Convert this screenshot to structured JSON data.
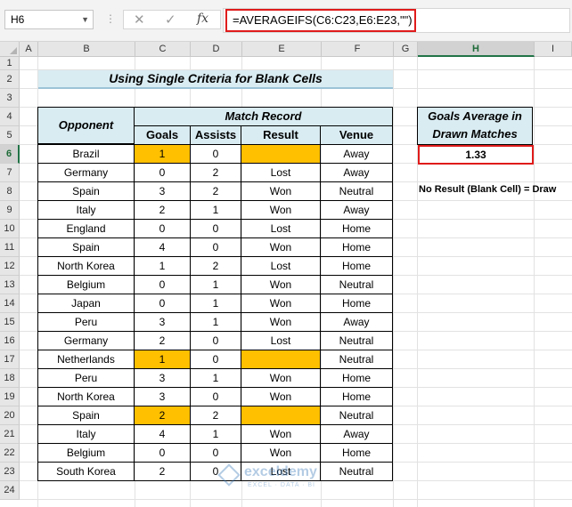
{
  "formula_bar": {
    "name_box": "H6",
    "dropdown_icon": "chevron-down-icon",
    "cancel_icon": "close-icon",
    "enter_icon": "checkmark-icon",
    "function_icon": "fx",
    "formula": "=AVERAGEIFS(C6:C23,E6:E23,\"\")"
  },
  "columns": [
    "A",
    "B",
    "C",
    "D",
    "E",
    "F",
    "G",
    "H",
    "I"
  ],
  "rows": [
    "1",
    "2",
    "3",
    "4",
    "5",
    "6",
    "7",
    "8",
    "9",
    "10",
    "11",
    "12",
    "13",
    "14",
    "15",
    "16",
    "17",
    "18",
    "19",
    "20",
    "21",
    "22",
    "23",
    "24"
  ],
  "selected_cell": "H6",
  "sheet": {
    "title": "Using Single Criteria for Blank Cells",
    "header_opponent": "Opponent",
    "header_match_record": "Match Record",
    "header_goals": "Goals",
    "header_assists": "Assists",
    "header_result": "Result",
    "header_venue": "Venue",
    "table_rows": [
      {
        "opponent": "Brazil",
        "goals": "1",
        "assists": "0",
        "result": "",
        "venue": "Away",
        "highlight": true
      },
      {
        "opponent": "Germany",
        "goals": "0",
        "assists": "2",
        "result": "Lost",
        "venue": "Away",
        "highlight": false
      },
      {
        "opponent": "Spain",
        "goals": "3",
        "assists": "2",
        "result": "Won",
        "venue": "Neutral",
        "highlight": false
      },
      {
        "opponent": "Italy",
        "goals": "2",
        "assists": "1",
        "result": "Won",
        "venue": "Away",
        "highlight": false
      },
      {
        "opponent": "England",
        "goals": "0",
        "assists": "0",
        "result": "Lost",
        "venue": "Home",
        "highlight": false
      },
      {
        "opponent": "Spain",
        "goals": "4",
        "assists": "0",
        "result": "Won",
        "venue": "Home",
        "highlight": false
      },
      {
        "opponent": "North Korea",
        "goals": "1",
        "assists": "2",
        "result": "Lost",
        "venue": "Home",
        "highlight": false
      },
      {
        "opponent": "Belgium",
        "goals": "0",
        "assists": "1",
        "result": "Won",
        "venue": "Neutral",
        "highlight": false
      },
      {
        "opponent": "Japan",
        "goals": "0",
        "assists": "1",
        "result": "Won",
        "venue": "Home",
        "highlight": false
      },
      {
        "opponent": "Peru",
        "goals": "3",
        "assists": "1",
        "result": "Won",
        "venue": "Away",
        "highlight": false
      },
      {
        "opponent": "Germany",
        "goals": "2",
        "assists": "0",
        "result": "Lost",
        "venue": "Neutral",
        "highlight": false
      },
      {
        "opponent": "Netherlands",
        "goals": "1",
        "assists": "0",
        "result": "",
        "venue": "Neutral",
        "highlight": true
      },
      {
        "opponent": "Peru",
        "goals": "3",
        "assists": "1",
        "result": "Won",
        "venue": "Home",
        "highlight": false
      },
      {
        "opponent": "North Korea",
        "goals": "3",
        "assists": "0",
        "result": "Won",
        "venue": "Home",
        "highlight": false
      },
      {
        "opponent": "Spain",
        "goals": "2",
        "assists": "2",
        "result": "",
        "venue": "Neutral",
        "highlight": true
      },
      {
        "opponent": "Italy",
        "goals": "4",
        "assists": "1",
        "result": "Won",
        "venue": "Away",
        "highlight": false
      },
      {
        "opponent": "Belgium",
        "goals": "0",
        "assists": "0",
        "result": "Won",
        "venue": "Home",
        "highlight": false
      },
      {
        "opponent": "South Korea",
        "goals": "2",
        "assists": "0",
        "result": "Lost",
        "venue": "Neutral",
        "highlight": false
      }
    ],
    "result_header_line1": "Goals Average in",
    "result_header_line2": "Drawn Matches",
    "result_value": "1.33",
    "note": "No Result (Blank Cell) = Draw"
  },
  "watermark": {
    "name": "exceldemy",
    "tagline": "EXCEL · DATA · BI"
  },
  "colors": {
    "header_fill": "#d9ecf2",
    "highlight_fill": "#ffc000",
    "outline_red": "#e01b1b",
    "selection_green": "#217346"
  }
}
